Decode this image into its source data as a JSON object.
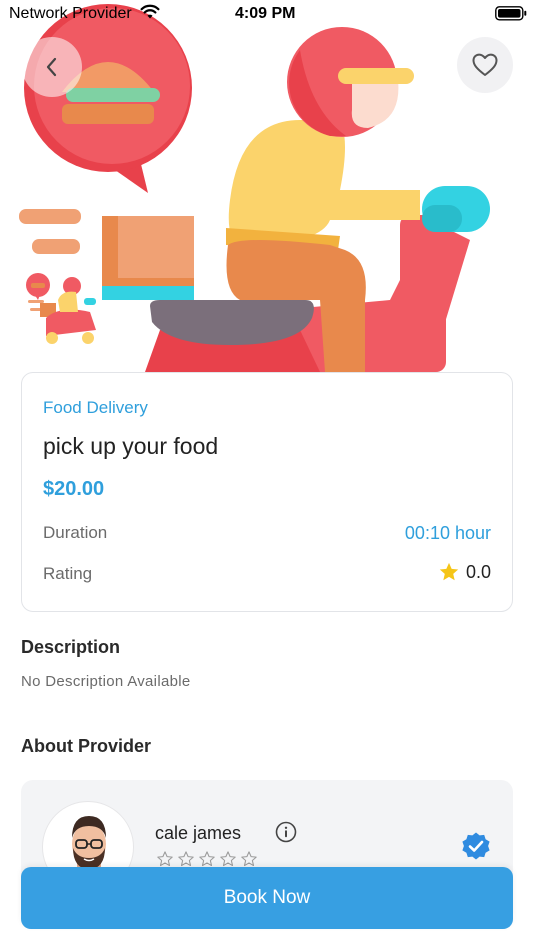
{
  "status_bar": {
    "carrier": "Network Provider",
    "time": "4:09 PM"
  },
  "icons": {
    "back": "chevron-left-icon",
    "favorite": "heart-outline-icon",
    "rating": "star-icon",
    "info": "info-icon",
    "verified": "verified-badge-icon"
  },
  "service": {
    "category": "Food Delivery",
    "title": "pick up your food",
    "price": "$20.00",
    "duration_label": "Duration",
    "duration_value": "00:10 hour",
    "rating_label": "Rating",
    "rating_value": "0.0"
  },
  "description": {
    "heading": "Description",
    "text": "No Description Available"
  },
  "provider": {
    "heading": "About Provider",
    "name": "cale james",
    "rating_stars": 0
  },
  "actions": {
    "book_now": "Book Now"
  },
  "colors": {
    "accent": "#379fe2",
    "link_blue": "#2f9fdc",
    "star_gold": "#f5c518",
    "verified": "#2f8be0"
  }
}
